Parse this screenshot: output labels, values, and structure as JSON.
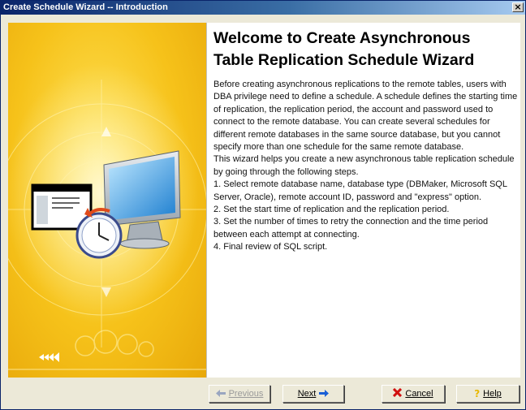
{
  "window": {
    "title": "Create Schedule Wizard -- Introduction",
    "close_glyph": "×"
  },
  "header": {
    "title_line1": "Welcome to Create Asynchronous",
    "title_line2": "Table Replication Schedule Wizard"
  },
  "body": {
    "paragraphs": [
      "Before creating asynchronous replications to the remote tables, users with DBA privilege need to define a schedule. A schedule defines the starting time of replication, the replication period, the account and password used to connect to the remote database. You can create several schedules for different remote databases in the same source database, but you cannot specify more than one schedule for the same remote database.",
      "This wizard helps you create a new asynchronous table replication schedule by going through the following steps.",
      "1. Select remote database name, database type (DBMaker, Microsoft SQL Server, Oracle), remote account ID, password and \"express\" option.",
      "2. Set the start time of replication and the replication period.",
      "3. Set the number of times to retry the connection and the time period between each attempt at connecting.",
      "4. Final review of SQL script."
    ]
  },
  "buttons": {
    "previous": "Previous",
    "next": "Next",
    "cancel": "Cancel",
    "help": "Help"
  },
  "colors": {
    "title_bar": "#0a246a",
    "banner_yellow": "#f6c21a",
    "cancel_icon": "#d01010",
    "help_icon": "#e8b800",
    "arrow_icon": "#1a5fd6"
  },
  "icons": {
    "side_banner": "computer-clock-window-illustration",
    "previous": "arrow-left-icon",
    "next": "arrow-right-icon",
    "cancel": "x-icon",
    "help": "question-icon"
  }
}
